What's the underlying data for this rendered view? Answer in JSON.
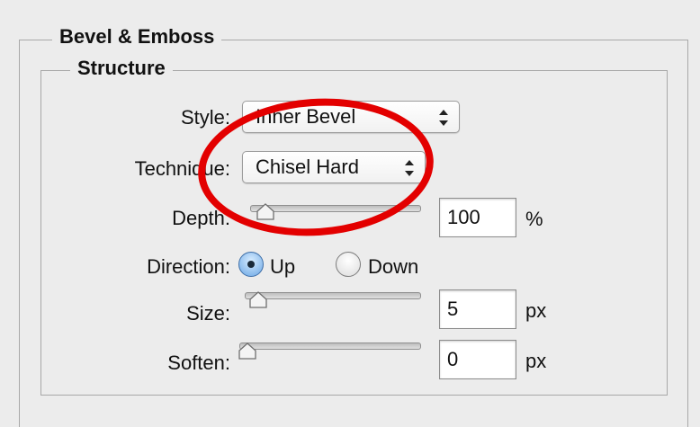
{
  "bevel_emboss": {
    "title": "Bevel & Emboss",
    "structure": {
      "title": "Structure",
      "style": {
        "label": "Style:",
        "value": "Inner Bevel"
      },
      "technique": {
        "label": "Technique:",
        "value": "Chisel Hard"
      },
      "depth": {
        "label": "Depth:",
        "value": "100",
        "unit": "%",
        "slider_level": 0.1
      },
      "direction": {
        "label": "Direction:",
        "options": [
          "Up",
          "Down"
        ],
        "selected": "Up"
      },
      "size": {
        "label": "Size:",
        "value": "5",
        "unit": "px",
        "slider_level": 0.0
      },
      "soften": {
        "label": "Soften:",
        "value": "0",
        "unit": "px",
        "slider_level": 0.0
      }
    }
  },
  "annotation": {
    "color": "#e30000"
  },
  "icons": [
    "up-down-arrows-icon",
    "slider-thumb-icon",
    "radio-icon"
  ]
}
